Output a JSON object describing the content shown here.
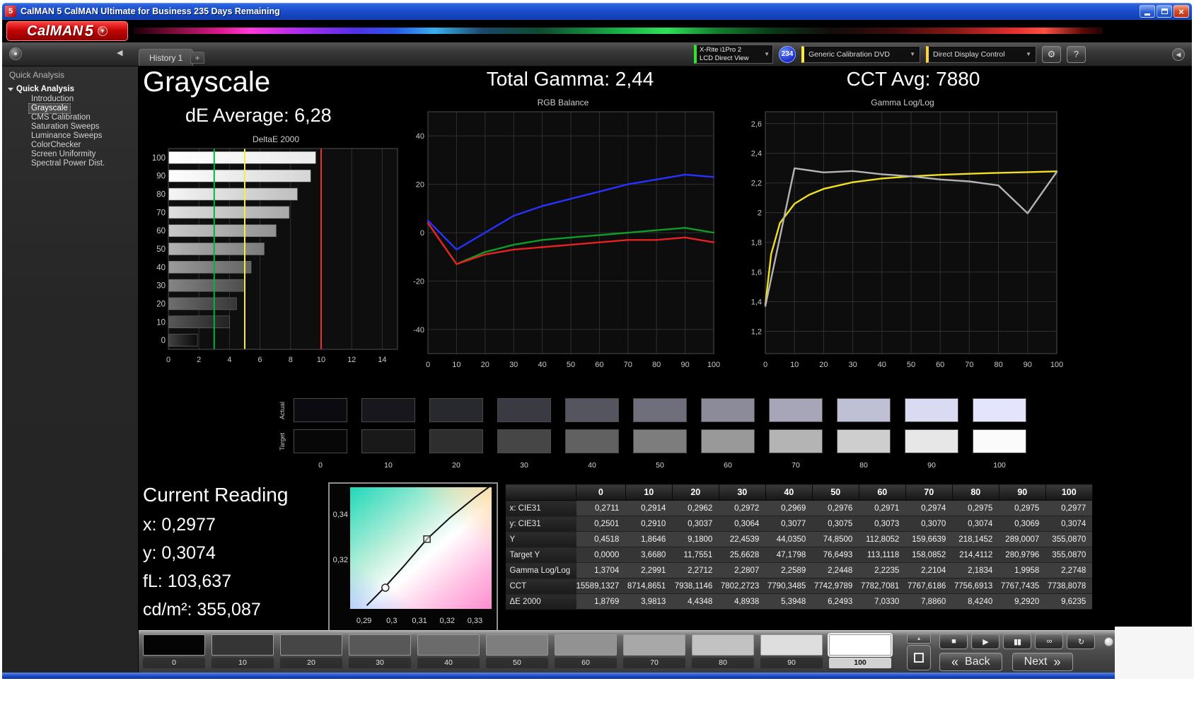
{
  "window": {
    "title": "CalMAN 5 CalMAN Ultimate for Business 235 Days Remaining",
    "icon_text": "5",
    "controls": {
      "close": "×"
    }
  },
  "logo": {
    "brand": "CalMAN",
    "version": "5",
    "caret": "▼"
  },
  "toolbar": {
    "history_tab": "History 1",
    "add_tab": "+",
    "collapse_icon": "◀",
    "meter_line1": "X-Rite i1Pro 2",
    "meter_line2": "LCD Direct View",
    "meter_badge": "234",
    "source_label": "Generic Calibration DVD",
    "display_control_label": "Direct Display Control",
    "dropdown_icon": "▼",
    "gear_icon": "⚙",
    "help_icon": "?",
    "right_collapse_icon": "◀",
    "accent_green": "#2ce62c",
    "accent_yellow": "#ffe83c"
  },
  "sidebar": {
    "header": "Quick Analysis",
    "root": "Quick Analysis",
    "items": [
      "Introduction",
      "Grayscale",
      "CMS Calibration",
      "Saturation Sweeps",
      "Luminance Sweeps",
      "ColorChecker",
      "Screen Uniformity",
      "Spectral Power Dist."
    ],
    "selected_index": 1
  },
  "headings": {
    "page_title": "Grayscale",
    "de_average": "dE Average: 6,28",
    "total_gamma": "Total Gamma: 2,44",
    "cct_avg": "CCT Avg: 7880"
  },
  "chart_data": [
    {
      "type": "bar",
      "title": "DeltaE 2000",
      "orientation": "horizontal",
      "categories": [
        "100",
        "90",
        "80",
        "70",
        "60",
        "50",
        "40",
        "30",
        "20",
        "10",
        "0"
      ],
      "values": [
        9.6235,
        9.292,
        8.424,
        7.886,
        7.033,
        6.2493,
        5.3948,
        4.8938,
        4.4348,
        3.9813,
        1.8769
      ],
      "xlim": [
        0,
        15
      ],
      "x_ticks": [
        0,
        2,
        4,
        6,
        8,
        10,
        12,
        14
      ],
      "reference_lines": [
        {
          "name": "good",
          "value": 3,
          "color": "#00b43c"
        },
        {
          "name": "warning",
          "value": 5,
          "color": "#f0f03c"
        },
        {
          "name": "bad",
          "value": 10,
          "color": "#e83030"
        }
      ]
    },
    {
      "type": "line",
      "title": "RGB Balance",
      "x": [
        0,
        10,
        20,
        30,
        40,
        50,
        60,
        70,
        80,
        90,
        100
      ],
      "x_ticks": [
        0,
        10,
        20,
        30,
        40,
        50,
        60,
        70,
        80,
        90,
        100
      ],
      "ylim": [
        -50,
        50
      ],
      "y_ticks": [
        40,
        20,
        0,
        -20,
        -40
      ],
      "series": [
        {
          "name": "Blue",
          "color": "#2832ff",
          "values": [
            5,
            -7,
            0,
            7,
            11,
            14,
            17,
            20,
            22,
            24,
            23
          ]
        },
        {
          "name": "Green",
          "color": "#0f9c28",
          "values": [
            4,
            -13,
            -8,
            -5,
            -3,
            -2,
            -1,
            0,
            1,
            2,
            0
          ]
        },
        {
          "name": "Red",
          "color": "#e82020",
          "values": [
            4,
            -13,
            -9,
            -7,
            -6,
            -5,
            -4,
            -3,
            -3,
            -2,
            -4
          ]
        }
      ]
    },
    {
      "type": "line",
      "title": "Gamma Log/Log",
      "x": [
        0,
        10,
        20,
        30,
        40,
        50,
        60,
        70,
        80,
        90,
        100
      ],
      "x_ticks": [
        0,
        10,
        20,
        30,
        40,
        50,
        60,
        70,
        80,
        90,
        100
      ],
      "ylim": [
        1.05,
        2.68
      ],
      "y_ticks": [
        2.6,
        2.4,
        2.2,
        2.0,
        1.8,
        1.6,
        1.4,
        1.2
      ],
      "y_tick_labels": [
        "2,6",
        "2,4",
        "2,2",
        "2",
        "1,8",
        "1,6",
        "1,4",
        "1,2"
      ],
      "series": [
        {
          "name": "Target",
          "color": "#f0e020",
          "x": [
            0,
            2,
            5,
            10,
            15,
            20,
            30,
            40,
            50,
            60,
            70,
            80,
            90,
            100
          ],
          "values": [
            1.38,
            1.72,
            1.93,
            2.06,
            2.12,
            2.16,
            2.205,
            2.23,
            2.245,
            2.255,
            2.262,
            2.268,
            2.273,
            2.278
          ]
        },
        {
          "name": "Measured",
          "color": "#b4b4b4",
          "values": [
            1.3704,
            2.2991,
            2.2712,
            2.2807,
            2.2589,
            2.2448,
            2.2235,
            2.2104,
            2.1834,
            1.9958,
            2.2748
          ]
        }
      ]
    },
    {
      "type": "scatter",
      "title": "CIE xy",
      "xlim": [
        0.285,
        0.336
      ],
      "ylim": [
        0.298,
        0.352
      ],
      "x_ticks": [
        0.29,
        0.3,
        0.31,
        0.32,
        0.33
      ],
      "x_tick_labels": [
        "0,29",
        "0,3",
        "0,31",
        "0,32",
        "0,33"
      ],
      "y_ticks": [
        0.34,
        0.32
      ],
      "y_tick_labels": [
        "0,34",
        "0,32"
      ],
      "locus": [
        [
          0.291,
          0.2995
        ],
        [
          0.297,
          0.307
        ],
        [
          0.304,
          0.3165
        ],
        [
          0.3127,
          0.329
        ],
        [
          0.321,
          0.3385
        ],
        [
          0.33,
          0.3475
        ],
        [
          0.336,
          0.353
        ]
      ],
      "target_point": [
        0.3127,
        0.329
      ],
      "measured_point": [
        0.2977,
        0.3074
      ]
    }
  ],
  "swatch_strip": {
    "row_labels": [
      "Actual",
      "Target"
    ],
    "columns": [
      "0",
      "10",
      "20",
      "30",
      "40",
      "50",
      "60",
      "70",
      "80",
      "90",
      "100"
    ],
    "actual_colors": [
      "#0b0b10",
      "#17171d",
      "#28282f",
      "#3a3a42",
      "#555560",
      "#6f6f7c",
      "#8b8b9a",
      "#a6a6b8",
      "#c0c0d4",
      "#dadaf2",
      "#e4e4fd"
    ],
    "target_colors": [
      "#070707",
      "#191919",
      "#2e2e2e",
      "#464646",
      "#616161",
      "#7d7d7d",
      "#999999",
      "#b4b4b4",
      "#cecece",
      "#e7e7e7",
      "#fbfbfb"
    ]
  },
  "current_reading": {
    "title": "Current Reading",
    "lines": [
      "x: 0,2977",
      "y: 0,3074",
      "fL: 103,637",
      "cd/m²: 355,087"
    ]
  },
  "table": {
    "columns": [
      "0",
      "10",
      "20",
      "30",
      "40",
      "50",
      "60",
      "70",
      "80",
      "90",
      "100"
    ],
    "rows": [
      {
        "label": "x: CIE31",
        "values": [
          "0,2711",
          "0,2914",
          "0,2962",
          "0,2972",
          "0,2969",
          "0,2976",
          "0,2971",
          "0,2974",
          "0,2975",
          "0,2975",
          "0,2977"
        ]
      },
      {
        "label": "y: CIE31",
        "values": [
          "0,2501",
          "0,2910",
          "0,3037",
          "0,3064",
          "0,3077",
          "0,3075",
          "0,3073",
          "0,3070",
          "0,3074",
          "0,3069",
          "0,3074"
        ]
      },
      {
        "label": "Y",
        "values": [
          "0,4518",
          "1,8646",
          "9,1800",
          "22,4539",
          "44,0350",
          "74,8500",
          "112,8052",
          "159,6639",
          "218,1452",
          "289,0007",
          "355,0870"
        ]
      },
      {
        "label": "Target Y",
        "values": [
          "0,0000",
          "3,6680",
          "11,7551",
          "25,6628",
          "47,1798",
          "76,6493",
          "113,1118",
          "158,0852",
          "214,4112",
          "280,9796",
          "355,0870"
        ]
      },
      {
        "label": "Gamma Log/Log",
        "values": [
          "1,3704",
          "2,2991",
          "2,2712",
          "2,2807",
          "2,2589",
          "2,2448",
          "2,2235",
          "2,2104",
          "2,1834",
          "1,9958",
          "2,2748"
        ]
      },
      {
        "label": "CCT",
        "values": [
          "15589,1327",
          "8714,8651",
          "7938,1146",
          "7802,2723",
          "7790,3485",
          "7742,9789",
          "7782,7081",
          "7767,6186",
          "7756,6913",
          "7767,7435",
          "7738,8078"
        ]
      },
      {
        "label": "ΔE 2000",
        "values": [
          "1,8769",
          "3,9813",
          "4,4348",
          "4,8938",
          "5,3948",
          "6,2493",
          "7,0330",
          "7,8860",
          "8,4240",
          "9,2920",
          "9,6235"
        ]
      }
    ]
  },
  "bottom_bar": {
    "patches": [
      {
        "label": "0",
        "color": "#040404"
      },
      {
        "label": "10",
        "color": "#353535"
      },
      {
        "label": "20",
        "color": "#464646"
      },
      {
        "label": "30",
        "color": "#585858"
      },
      {
        "label": "40",
        "color": "#6b6b6b"
      },
      {
        "label": "50",
        "color": "#7e7e7e"
      },
      {
        "label": "60",
        "color": "#929292"
      },
      {
        "label": "70",
        "color": "#a8a8a8"
      },
      {
        "label": "80",
        "color": "#c2c2c2"
      },
      {
        "label": "90",
        "color": "#dedede"
      },
      {
        "label": "100",
        "color": "#ffffff"
      }
    ],
    "selected_patch": "100",
    "stack_top_icon": "▴",
    "transport_icons": [
      {
        "name": "stop",
        "glyph": "■"
      },
      {
        "name": "play",
        "glyph": "▶"
      },
      {
        "name": "pause",
        "glyph": "▮▮"
      },
      {
        "name": "continuous",
        "glyph": "∞"
      },
      {
        "name": "loop",
        "glyph": "↻"
      }
    ],
    "back_chevron": "«",
    "back_label": "Back",
    "next_label": "Next",
    "next_chevron": "»"
  }
}
